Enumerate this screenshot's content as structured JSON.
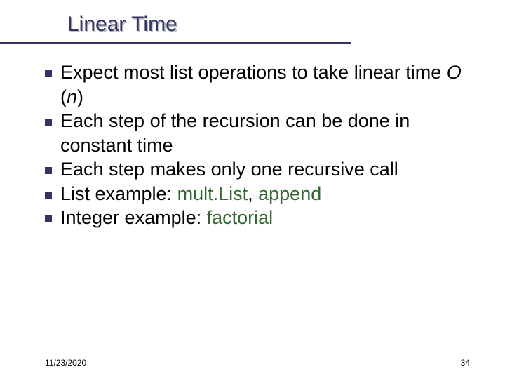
{
  "title": "Linear Time",
  "bullets": {
    "b1_a": "Expect most list operations to take linear time ",
    "b1_O": "O",
    "b1_paren1": " (",
    "b1_n": "n",
    "b1_paren2": ")",
    "b2": "Each step of the recursion can be done in constant time",
    "b3": "Each step makes only one recursive call",
    "b4_a": "List example: ",
    "b4_code1": "mult.List",
    "b4_sep": ", ",
    "b4_code2": "append",
    "b5_a": "Integer example: ",
    "b5_code": "factorial"
  },
  "footer": {
    "date": "11/23/2020",
    "page": "34"
  }
}
